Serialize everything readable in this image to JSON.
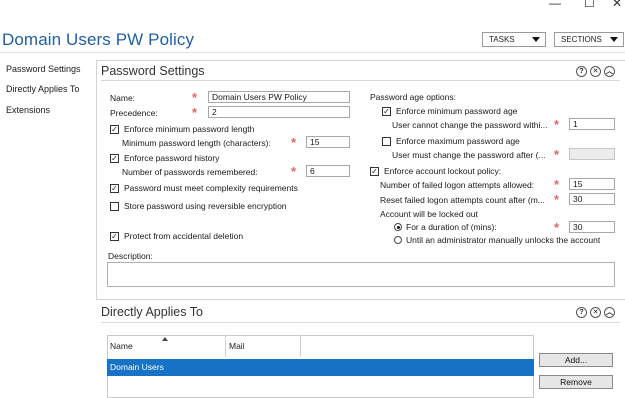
{
  "window": {
    "minimize": "—",
    "maximize": "☐",
    "close": "✕"
  },
  "page_title": "Domain Users PW Policy",
  "header_buttons": {
    "tasks": "TASKS",
    "sections": "SECTIONS"
  },
  "nav": [
    "Password Settings",
    "Directly Applies To",
    "Extensions"
  ],
  "password_settings": {
    "title": "Password Settings",
    "name_label": "Name:",
    "name_value": "Domain Users PW Policy",
    "precedence_label": "Precedence:",
    "precedence_value": "2",
    "enforce_min_length": {
      "label": "Enforce minimum password length",
      "checked": true
    },
    "min_length_label": "Minimum password length (characters):",
    "min_length_value": "15",
    "enforce_history": {
      "label": "Enforce password history",
      "checked": true
    },
    "history_label": "Number of passwords remembered:",
    "history_value": "6",
    "complexity": {
      "label": "Password must meet complexity requirements",
      "checked": true
    },
    "reversible": {
      "label": "Store password using reversible encryption",
      "checked": false
    },
    "protect_deletion": {
      "label": "Protect from accidental deletion",
      "checked": true
    },
    "description_label": "Description:",
    "age_options_label": "Password age options:",
    "enforce_min_age": {
      "label": "Enforce minimum password age",
      "checked": true
    },
    "min_age_label": "User cannot change the password withi...",
    "min_age_value": "1",
    "enforce_max_age": {
      "label": "Enforce maximum password age",
      "checked": false
    },
    "max_age_label": "User must change the password after (...",
    "max_age_value": "",
    "lockout_policy": {
      "label": "Enforce account lockout policy:",
      "checked": true
    },
    "failed_attempts_label": "Number of failed logon attempts allowed:",
    "failed_attempts_value": "15",
    "reset_after_label": "Reset failed logon attempts count after (m...",
    "reset_after_value": "30",
    "locked_out_label": "Account will be locked out",
    "duration_option": {
      "label": "For a duration of (mins):",
      "selected": true
    },
    "duration_value": "30",
    "admin_unlock_option": {
      "label": "Until an administrator manually unlocks the account",
      "selected": false
    }
  },
  "directly_applies_to": {
    "title": "Directly Applies To",
    "columns": [
      "Name",
      "Mail"
    ],
    "rows": [
      {
        "name": "Domain Users",
        "mail": ""
      }
    ],
    "add_button": "Add...",
    "remove_button": "Remove"
  },
  "section_icons": {
    "help": "?",
    "close": "✕",
    "collapse": "︿"
  },
  "colors": {
    "title_blue": "#1f5fa8",
    "selection_blue": "#1673c6",
    "required_star": "#e06666"
  }
}
